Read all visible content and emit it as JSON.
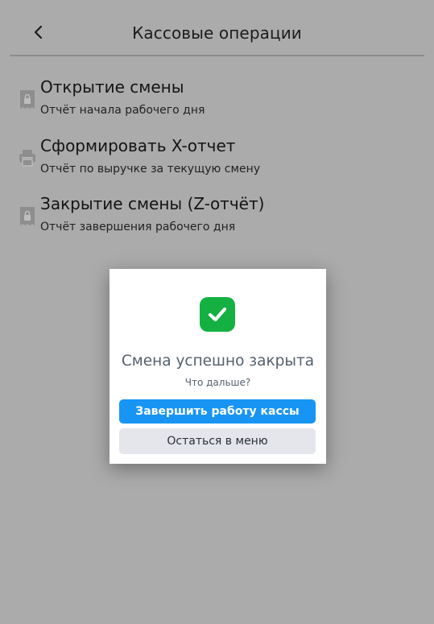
{
  "header": {
    "title": "Кассовые операции",
    "back_icon": "chevron-left-icon"
  },
  "menu": [
    {
      "icon": "receipt-lock-icon",
      "title": "Открытие смены",
      "description": "Отчёт начала рабочего дня"
    },
    {
      "icon": "printer-icon",
      "title": "Сформировать X-отчет",
      "description": "Отчёт по выручке за текущую смену"
    },
    {
      "icon": "receipt-lock-icon",
      "title": "Закрытие смены (Z-отчёт)",
      "description": "Отчёт завершения рабочего дня"
    }
  ],
  "dialog": {
    "icon": "check-icon",
    "title": "Смена успешно закрыта",
    "subtitle": "Что дальше?",
    "primary_label": "Завершить работу кассы",
    "secondary_label": "Остаться в меню"
  },
  "colors": {
    "overlay": "#ababab",
    "success": "#14b142",
    "primary": "#1895f4",
    "secondary": "#e4e6ec",
    "dialog_text": "#55606e"
  }
}
